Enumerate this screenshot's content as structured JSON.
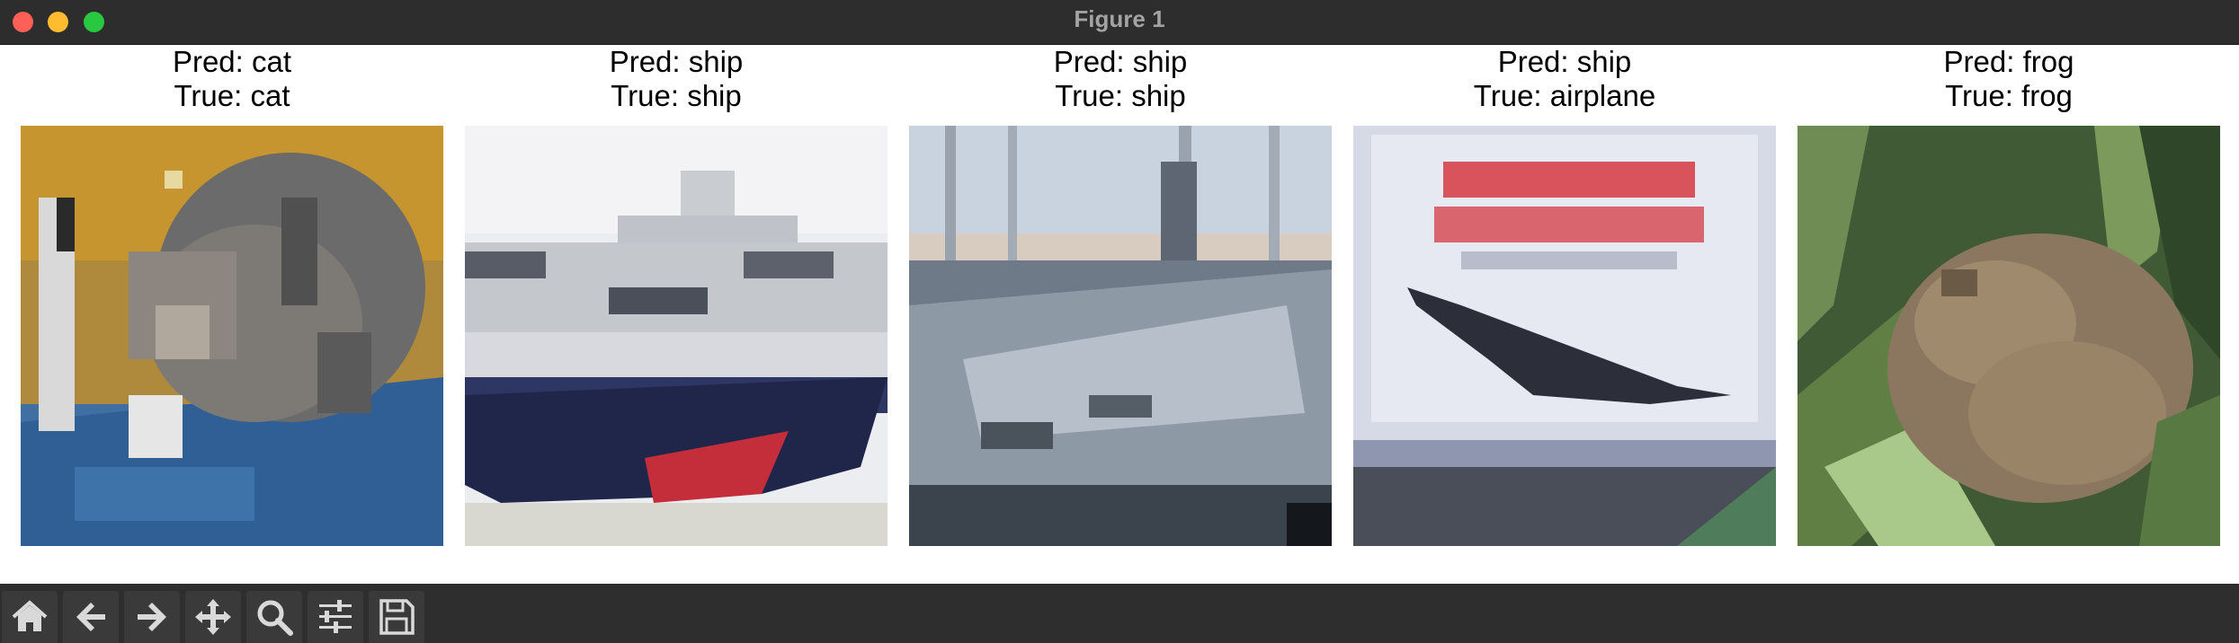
{
  "window": {
    "title": "Figure 1"
  },
  "panels": [
    {
      "pred": "Pred: cat",
      "true": "True: cat",
      "image": "cat on blanket"
    },
    {
      "pred": "Pred: ship",
      "true": "True: ship",
      "image": "cruise ship"
    },
    {
      "pred": "Pred: ship",
      "true": "True: ship",
      "image": "ship at dock"
    },
    {
      "pred": "Pred: ship",
      "true": "True: airplane",
      "image": "concorde airplane on sign"
    },
    {
      "pred": "Pred: frog",
      "true": "True: frog",
      "image": "frog in grass"
    }
  ],
  "toolbar": {
    "buttons": [
      "home-icon",
      "back-arrow-icon",
      "forward-arrow-icon",
      "pan-icon",
      "zoom-icon",
      "configure-subplots-icon",
      "save-icon"
    ]
  },
  "colors": {
    "titlebar": "#2d2d2d",
    "toolbar": "#2e2e2e"
  }
}
